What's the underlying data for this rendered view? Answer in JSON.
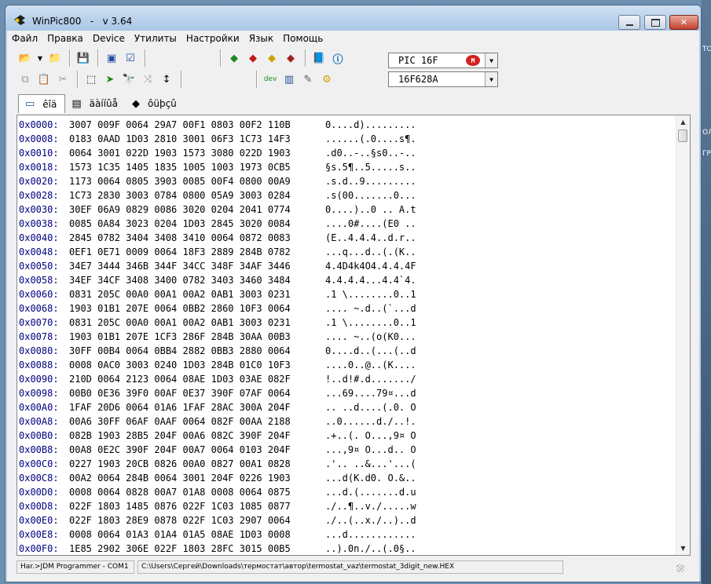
{
  "window": {
    "app_name": "WinPic800",
    "version": "v 3.64"
  },
  "menu": [
    "Файл",
    "Правка",
    "Device",
    "Утилиты",
    "Настройки",
    "Язык",
    "Помощь"
  ],
  "chip": {
    "family": "PIC 16F",
    "model": "16F628A"
  },
  "tabs": [
    {
      "label": "êîä",
      "icon": "code-icon"
    },
    {
      "label": "äàííûå",
      "icon": "data-icon"
    },
    {
      "label": "ôüþçû",
      "icon": "fuses-icon"
    }
  ],
  "hex_rows": [
    {
      "addr": "0x0000:",
      "hex": "3007 009F 0064 29A7 00F1 0803 00F2 110B",
      "ascii": "0....d)........."
    },
    {
      "addr": "0x0008:",
      "hex": "0183 0AAD 1D03 2810 3001 06F3 1C73 14F3",
      "ascii": "......(.0....s¶."
    },
    {
      "addr": "0x0010:",
      "hex": "0064 3001 022D 1903 1573 3080 022D 1903",
      "ascii": ".d0..-..§s0..-.."
    },
    {
      "addr": "0x0018:",
      "hex": "1573 1C35 1405 1835 1005 1003 1973 0CB5",
      "ascii": "§s.5¶..5.....s.."
    },
    {
      "addr": "0x0020:",
      "hex": "1173 0064 0805 3903 0085 00F4 0800 00A9",
      "ascii": ".s.d..9........."
    },
    {
      "addr": "0x0028:",
      "hex": "1C73 2830 3003 0784 0800 05A9 3003 0284",
      "ascii": ".s(00.......0..."
    },
    {
      "addr": "0x0030:",
      "hex": "30EF 06A9 0829 0086 3020 0204 2041 0774",
      "ascii": "0....)..0 .. A.t"
    },
    {
      "addr": "0x0038:",
      "hex": "0085 0A84 3023 0204 1D03 2845 3020 0084",
      "ascii": "....0#....(E0 .."
    },
    {
      "addr": "0x0040:",
      "hex": "2845 0782 3404 3408 3410 0064 0872 0083",
      "ascii": "(E..4.4.4..d.r.."
    },
    {
      "addr": "0x0048:",
      "hex": "0EF1 0E71 0009 0064 18F3 2889 284B 0782",
      "ascii": "...q...d..(.(K.."
    },
    {
      "addr": "0x0050:",
      "hex": "34E7 3444 346B 344F 34CC 348F 34AF 3446",
      "ascii": "4.4D4k4O4.4.4.4F"
    },
    {
      "addr": "0x0058:",
      "hex": "34EF 34CF 3408 3400 0782 3403 3460 3484",
      "ascii": "4.4.4.4...4.4`4."
    },
    {
      "addr": "0x0060:",
      "hex": "0831 205C 00A0 00A1 00A2 0AB1 3003 0231",
      "ascii": ".1 \\........0..1"
    },
    {
      "addr": "0x0068:",
      "hex": "1903 01B1 207E 0064 0BB2 2860 10F3 0064",
      "ascii": ".... ~.d..(`...d"
    },
    {
      "addr": "0x0070:",
      "hex": "0831 205C 00A0 00A1 00A2 0AB1 3003 0231",
      "ascii": ".1 \\........0..1"
    },
    {
      "addr": "0x0078:",
      "hex": "1903 01B1 207E 1CF3 286F 284B 30AA 00B3",
      "ascii": ".... ~..(o(K0..."
    },
    {
      "addr": "0x0080:",
      "hex": "30FF 00B4 0064 0BB4 2882 0BB3 2880 0064",
      "ascii": "0....d..(...(..d"
    },
    {
      "addr": "0x0088:",
      "hex": "0008 0AC0 3003 0240 1D03 284B 01C0 10F3",
      "ascii": "....0..@..(K...."
    },
    {
      "addr": "0x0090:",
      "hex": "210D 0064 2123 0064 08AE 1D03 03AE 082F",
      "ascii": "!..d!#.d......./"
    },
    {
      "addr": "0x0098:",
      "hex": "00B0 0E36 39F0 00AF 0E37 390F 07AF 0064",
      "ascii": "...69....79¤...d"
    },
    {
      "addr": "0x00A0:",
      "hex": "1FAF 20D6 0064 01A6 1FAF 28AC 300A 204F",
      "ascii": ".. ..d....(.0. O"
    },
    {
      "addr": "0x00A8:",
      "hex": "00A6 30FF 06AF 0AAF 0064 082F 00AA 2188",
      "ascii": "..0......d./..!."
    },
    {
      "addr": "0x00B0:",
      "hex": "082B 1903 28B5 204F 00A6 082C 390F 204F",
      "ascii": ".+..(. O...,9¤ O"
    },
    {
      "addr": "0x00B8:",
      "hex": "00A8 0E2C 390F 204F 00A7 0064 0103 204F",
      "ascii": "...,9¤ O...d.. O"
    },
    {
      "addr": "0x00C0:",
      "hex": "0227 1903 20CB 0826 00A0 0827 00A1 0828",
      "ascii": ".'.. ..&...'...("
    },
    {
      "addr": "0x00C8:",
      "hex": "00A2 0064 284B 0064 3001 204F 0226 1903",
      "ascii": "...d(K.d0. O.&.."
    },
    {
      "addr": "0x00D0:",
      "hex": "0008 0064 0828 00A7 01A8 0008 0064 0875",
      "ascii": "...d.(.......d.u"
    },
    {
      "addr": "0x00D8:",
      "hex": "022F 1803 1485 0876 022F 1C03 1085 0877",
      "ascii": "./..¶..v./.....w"
    },
    {
      "addr": "0x00E0:",
      "hex": "022F 1803 28E9 0878 022F 1C03 2907 0064",
      "ascii": "./..(..x./..)..d"
    },
    {
      "addr": "0x00E8:",
      "hex": "0008 0064 01A3 01A4 01A5 08AE 1D03 0008",
      "ascii": "...d............"
    },
    {
      "addr": "0x00F0:",
      "hex": "1E85 2902 306E 022F 1803 28FC 3015 00B5",
      "ascii": "..).0n./..(.0§.."
    }
  ],
  "status": {
    "programmer": "Нar.>JDM Programmer - COM1",
    "file_path": "C:\\Users\\Сергей\\Downloads\\термостат\\автор\\termostat_vaz\\termostat_3digit_new.HEX"
  },
  "desktop_edge_text": [
    "ТО",
    "ОЛ",
    "ГРА"
  ]
}
